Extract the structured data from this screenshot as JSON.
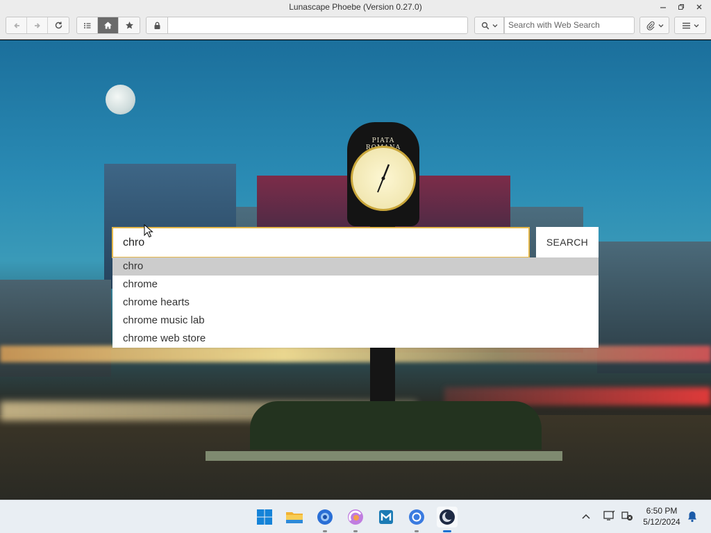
{
  "window": {
    "title": "Lunascape Phoebe (Version 0.27.0)",
    "controls": [
      "minimize",
      "restore",
      "close"
    ]
  },
  "toolbar": {
    "nav_icons": [
      "back-arrow-icon",
      "forward-arrow-icon",
      "reload-icon"
    ],
    "view_icons": [
      "list-icon",
      "home-icon",
      "star-icon"
    ],
    "url_value": "",
    "search_placeholder": "Search with Web Search"
  },
  "page": {
    "search": {
      "query": "chro",
      "button_label": "SEARCH",
      "suggestions": [
        "chro",
        "chrome",
        "chrome hearts",
        "chrome music lab",
        "chrome web store"
      ],
      "highlighted_index": 0
    },
    "clock_sign": "PIATA ROMANA"
  },
  "taskbar": {
    "apps": [
      "windows-start",
      "file-explorer",
      "browser-blue",
      "browser-rainbow",
      "store",
      "chrome",
      "lunascape"
    ],
    "time": "6:50 PM",
    "date": "5/12/2024"
  },
  "colors": {
    "accent_border": "#e6b84a",
    "highlight_row": "#cccccc",
    "active_indicator": "#1b6fd1"
  }
}
